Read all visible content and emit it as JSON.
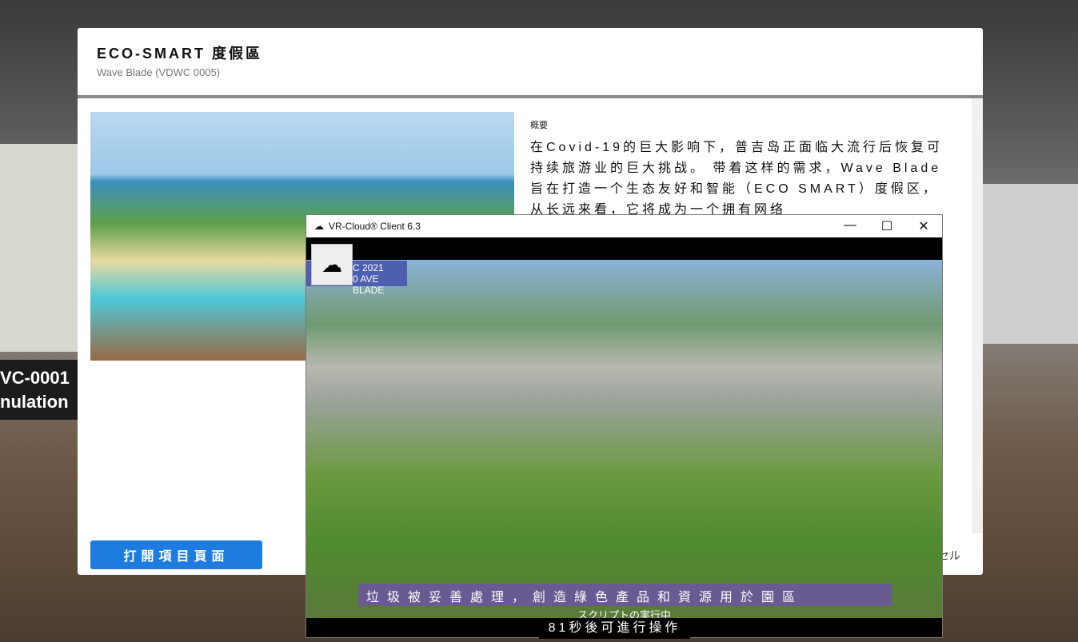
{
  "background": {
    "sign_top": "VC-0001",
    "sign_bottom": "nulation"
  },
  "modal": {
    "title": "ECO-SMART  度假區",
    "subtitle": "Wave Blade (VDWC 0005)",
    "description_label": "概要",
    "description": "在Covid-19的巨大影响下，普吉岛正面临大流行后恢复可持续旅游业的巨大挑战。 带着这样的需求，Wave Blade 旨在打造一个生态友好和智能（ECO SMART）度假区，从长远来看，它将成为一个拥有网络",
    "open_button": "打開項目頁面",
    "cancel_button": "セル"
  },
  "vr_window": {
    "title": "VR-Cloud® Client 6.3",
    "tag_line1": "C 2021",
    "tag_line2": "0 AVE BLADE",
    "subtitle": "垃圾被妥善處理，創造綠色產品和資源用於園區",
    "status": "スクリプトの実行中",
    "countdown": "81秒後可進行操作",
    "minimize": "—",
    "maximize": "☐",
    "close": "✕"
  }
}
